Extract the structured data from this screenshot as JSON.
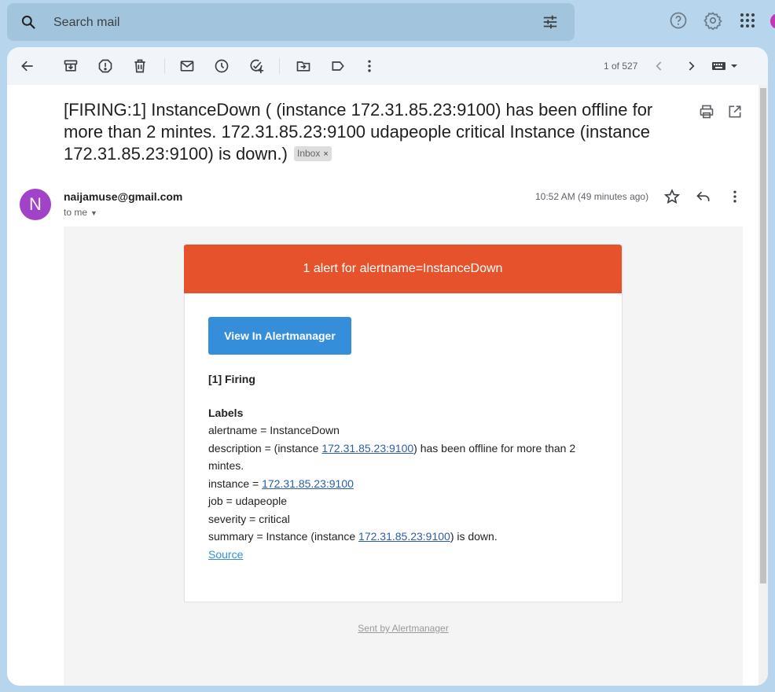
{
  "search": {
    "placeholder": "Search mail"
  },
  "toolbar": {
    "pager": "1 of 527"
  },
  "email": {
    "subject": "[FIRING:1] InstanceDown ( (instance 172.31.85.23:9100) has been offline for more than 2 mintes. 172.31.85.23:9100 udapeople critical Instance (instance 172.31.85.23:9100) is down.)",
    "label_chip": "Inbox",
    "label_chip_close": "×",
    "sender_initial": "N",
    "sender": "naijamuse@gmail.com",
    "to": "to me",
    "time": "10:52 AM (49 minutes ago)"
  },
  "alert": {
    "header": "1 alert for alertname=InstanceDown",
    "button": "View In Alertmanager",
    "firing": "[1] Firing",
    "labels_heading": "Labels",
    "alertname": "alertname = InstanceDown",
    "desc_prefix": "description = (instance ",
    "desc_link": "172.31.85.23:9100",
    "desc_suffix": ") has been offline for more than 2 mintes.",
    "instance_prefix": "instance = ",
    "instance_link": "172.31.85.23:9100",
    "job": "job = udapeople",
    "severity": "severity = critical",
    "summary_prefix": "summary = Instance (instance ",
    "summary_link": "172.31.85.23:9100",
    "summary_suffix": ") is down.",
    "source": "Source",
    "footer": "Sent by Alertmanager"
  },
  "colors": {
    "alert_header": "#e6522c",
    "button": "#348eda",
    "avatar": "#a142c8"
  },
  "icons": [
    "search-icon",
    "tune-icon",
    "help-icon",
    "settings-icon",
    "apps-icon",
    "back-arrow-icon",
    "archive-icon",
    "report-spam-icon",
    "delete-icon",
    "mark-unread-icon",
    "snooze-icon",
    "add-task-icon",
    "move-to-icon",
    "label-icon",
    "more-vert-icon",
    "prev-icon",
    "next-icon",
    "keyboard-icon",
    "print-icon",
    "open-new-window-icon",
    "star-icon",
    "reply-icon"
  ]
}
